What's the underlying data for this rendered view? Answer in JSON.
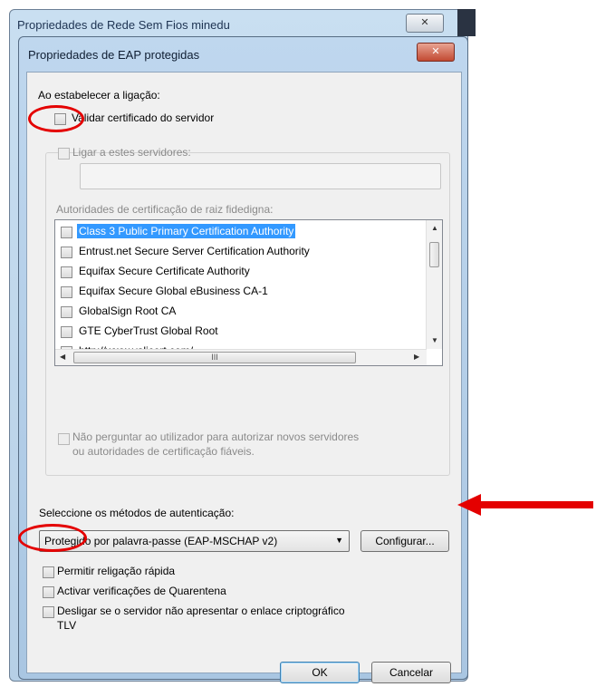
{
  "background_window": {
    "title": "Propriedades de Rede Sem Fios minedu",
    "close_label": "✕"
  },
  "dialog": {
    "title": "Propriedades de EAP protegidas",
    "close_label": "✕",
    "connect_label": "Ao estabelecer a ligação:",
    "validate_cert": "Validar certificado do servidor",
    "connect_servers": "Ligar a estes servidores:",
    "servers_value": "",
    "trusted_ca_label": "Autoridades de certificação de raiz fidedigna:",
    "ca_list": [
      "Class 3 Public Primary Certification Authority",
      "Entrust.net Secure Server Certification Authority",
      "Equifax Secure Certificate Authority",
      "Equifax Secure Global eBusiness CA-1",
      "GlobalSign Root CA",
      "GTE CyberTrust Global Root",
      "http://www.valicert.com/"
    ],
    "no_prompt_line1": "Não perguntar ao utilizador para autorizar novos servidores",
    "no_prompt_line2": "ou autoridades de certificação fiáveis.",
    "auth_method_label": "Seleccione os métodos de autenticação:",
    "auth_method_value": "Protegido por palavra-passe (EAP-MSCHAP v2)",
    "configure_label": "Configurar...",
    "fast_reconnect": "Permitir religação rápida",
    "quarantine": "Activar verificações de Quarentena",
    "disconnect_line1": "Desligar se o servidor não apresentar o enlace criptográfico",
    "disconnect_line2": "TLV",
    "ok_label": "OK",
    "cancel_label": "Cancelar"
  },
  "scroll_grip": "III",
  "colors": {
    "annotation": "#e40000",
    "selection": "#3399ff"
  }
}
